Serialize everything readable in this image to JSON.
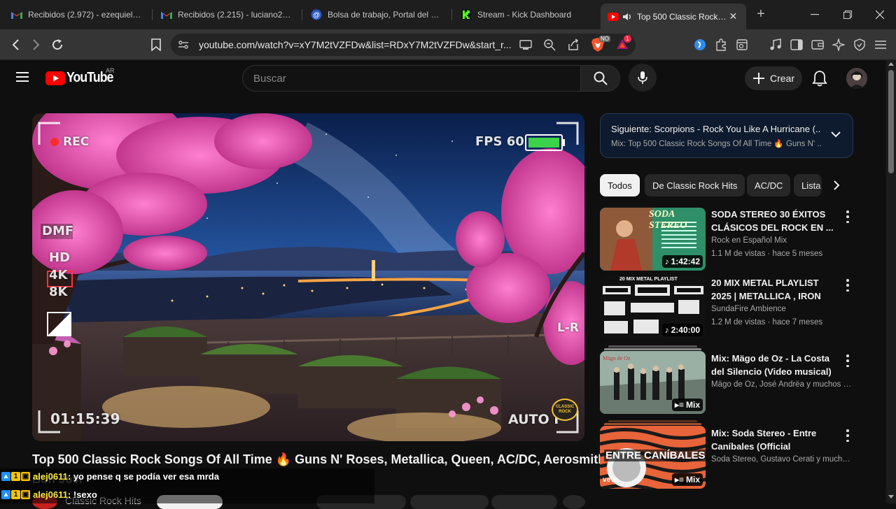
{
  "browser": {
    "tabs": [
      {
        "title": "Recibidos (2.972) - ezequiellucı",
        "icon": "gmail-icon"
      },
      {
        "title": "Recibidos (2.215) - luciano2002",
        "icon": "gmail-icon"
      },
      {
        "title": "Bolsa de trabajo, Portal del emp",
        "icon": "job-portal-icon"
      },
      {
        "title": "Stream - Kick Dashboard",
        "icon": "kick-icon"
      },
      {
        "title": "Top 500 Classic Rock So",
        "icon": "youtube-icon",
        "active": true
      }
    ],
    "url": "youtube.com/watch?v=xY7M2tVZFDw&list=RDxY7M2tVZFDw&start_r...",
    "brave_badge_count": "1"
  },
  "youtube": {
    "logo_text": "YouTube",
    "country_code": "AR",
    "search_placeholder": "Buscar",
    "create_label": "Crear"
  },
  "player": {
    "osd_rec": "REC",
    "osd_fps": "FPS 60",
    "osd_battery": "",
    "osd_dmf": "DMF",
    "osd_hd": "HD",
    "osd_4k": "4K",
    "osd_8k": "8K",
    "osd_lr": "L-R",
    "osd_time": "01:15:39",
    "osd_auto": "AUTO I",
    "corner_logo": "CLASSIC ROCK"
  },
  "video": {
    "title": "Top 500 Classic Rock Songs Of All Time 🔥 Guns N' Roses, Metallica, Queen, AC/DC, Aerosmith,",
    "channel_partial": "Classic Rock Hits"
  },
  "chat": [
    {
      "user": "alej0611",
      "message": ": yo pense q se podía ver esa mrda"
    },
    {
      "user": "alej0611",
      "message": ": !sexo"
    }
  ],
  "sidebar": {
    "next_label": "Siguiente:",
    "next_title": "Scorpions - Rock You Like A Hurricane (...",
    "next_subtitle": "Mix: Top 500 Classic Rock Songs Of All Time 🔥 Guns N' ...",
    "chips": [
      "Todos",
      "De Classic Rock Hits",
      "AC/DC",
      "Lista"
    ],
    "recommendations": [
      {
        "title": "SODA STEREO 30 ÉXITOS CLÁSICOS DEL ROCK EN ...",
        "channel": "Rock en Español Mix",
        "meta": "1.1 M de vistas · hace 5 meses",
        "duration": "1:42:42",
        "thumb_text": "SODA STEREO"
      },
      {
        "title": "20 MIX METAL PLAYLIST 2025 | METALLICA , IRON MAIDEN ,...",
        "channel": "SundaFire Ambience",
        "meta": "1.2 M de vistas · hace 7 meses",
        "duration": "2:40:00",
        "thumb_text": "20 MIX METAL PLAYLIST"
      },
      {
        "title": "Mix: Mägo de Oz - La Costa del Silencio (Video musical)",
        "channel": "Mägo de Oz, José Andrëa y muchos más",
        "meta": "",
        "duration": "Mix",
        "thumb_text": "Mägo de Oz"
      },
      {
        "title": "Mix: Soda Stereo - Entre Caníbales (Official Visualizer)",
        "channel": "Soda Stereo, Gustavo Cerati y muchos ...",
        "meta": "",
        "duration": "Mix",
        "thumb_text": "ENTRE CANÍBALES"
      }
    ]
  }
}
